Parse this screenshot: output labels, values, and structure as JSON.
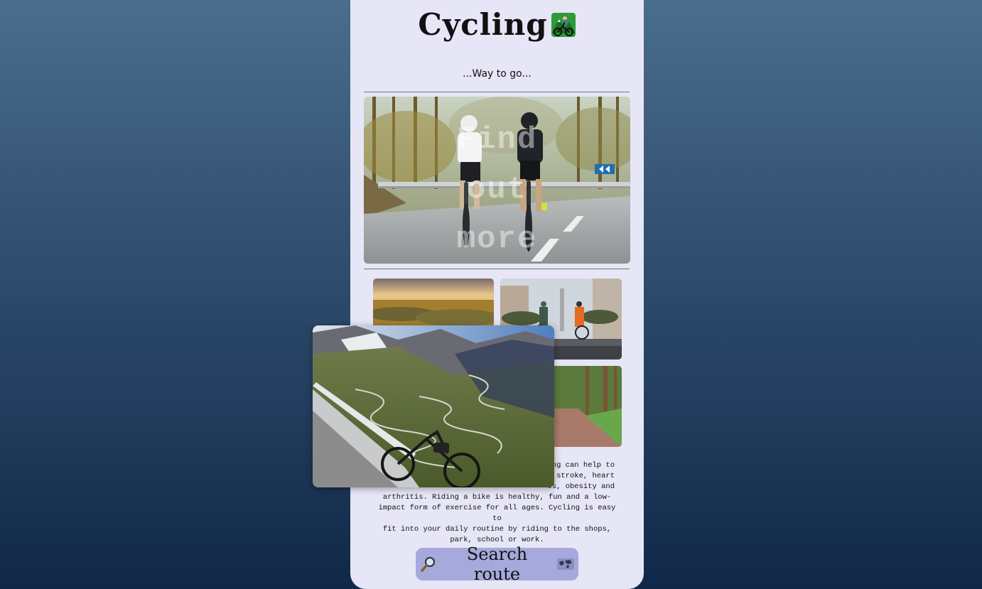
{
  "header": {
    "title": "Cycling",
    "title_emoji_icon": "mountain-biker-icon",
    "tagline": "...Way to go..."
  },
  "hero": {
    "overlay_lines": [
      "Find",
      "out",
      "more"
    ]
  },
  "gallery": {
    "images": [
      "sunset-hills-photo",
      "city-street-cyclists-photo",
      "forest-path-cyclists-photo"
    ]
  },
  "popup": {
    "image": "mountain-pass-bike-photo"
  },
  "description": {
    "visible_tail_line1": "ng can help to",
    "visible_tail_line2": "stroke, heart",
    "visible_tail_line3": "es, obesity and",
    "line4": "arthritis. Riding a bike is healthy, fun and a low-",
    "line5": "impact form of exercise for all ages. Cycling is easy to",
    "line6": "fit into your daily routine by riding to the shops,",
    "line7": "park, school or work."
  },
  "search": {
    "label": "Search route",
    "left_icon": "magnifier-icon",
    "right_icon": "world-map-icon"
  },
  "colors": {
    "card_bg": "#e6e6f6",
    "button_bg": "#a6a9db",
    "bg_top": "#4b6d8c",
    "bg_bottom": "#112848"
  }
}
